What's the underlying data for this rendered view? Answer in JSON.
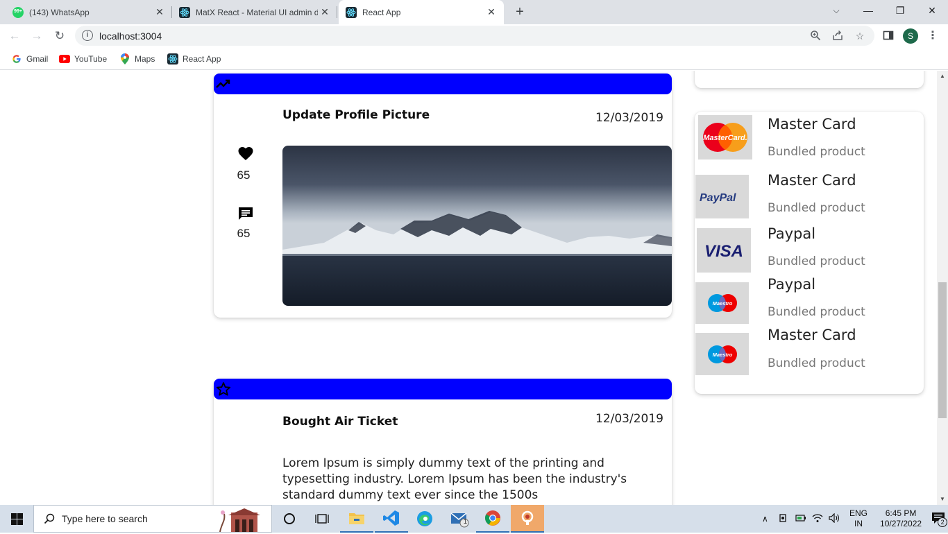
{
  "browser": {
    "tabs": [
      {
        "title": "(143) WhatsApp",
        "favicon": "whatsapp-icon",
        "badge": "99+"
      },
      {
        "title": "MatX React - Material UI admin d",
        "favicon": "react-icon"
      },
      {
        "title": "React App",
        "favicon": "react-icon",
        "active": true
      }
    ],
    "new_tab": "+",
    "url": "localhost:3004",
    "avatar_letter": "S",
    "bookmarks": [
      {
        "label": "Gmail",
        "icon": "google-icon"
      },
      {
        "label": "YouTube",
        "icon": "youtube-icon"
      },
      {
        "label": "Maps",
        "icon": "maps-icon"
      },
      {
        "label": "React App",
        "icon": "react-icon"
      }
    ]
  },
  "timeline": {
    "post": {
      "title": "Update Profile Picture",
      "date": "12/03/2019",
      "likes": "65",
      "comments": "65",
      "band_icon": "trending-up-icon",
      "band_color": "#0000ff"
    },
    "ticket": {
      "title": "Bought Air Ticket",
      "date": "12/03/2019",
      "body": "Lorem Ipsum is simply dummy text of the printing and typesetting industry. Lorem Ipsum has been the industry's standard dummy text ever since the 1500s",
      "band_icon": "star-outline-icon"
    }
  },
  "products": [
    {
      "name": "Master Card",
      "subtitle": "Bundled product",
      "logo": "mastercard-logo"
    },
    {
      "name": "Master Card",
      "subtitle": "Bundled product",
      "logo": "paypal-logo"
    },
    {
      "name": "Paypal",
      "subtitle": "Bundled product",
      "logo": "visa-logo"
    },
    {
      "name": "Paypal",
      "subtitle": "Bundled product",
      "logo": "maestro-logo"
    },
    {
      "name": "Master Card",
      "subtitle": "Bundled product",
      "logo": "maestro-logo"
    }
  ],
  "logo_text": {
    "mastercard": "MasterCard.",
    "paypal": "PayPal",
    "visa": "VISA",
    "maestro": "Maestro"
  },
  "taskbar": {
    "search_placeholder": "Type here to search",
    "language": "ENG",
    "region": "IN",
    "time": "6:45 PM",
    "date": "10/27/2022",
    "notifications": "2",
    "mail_badge": "1"
  }
}
